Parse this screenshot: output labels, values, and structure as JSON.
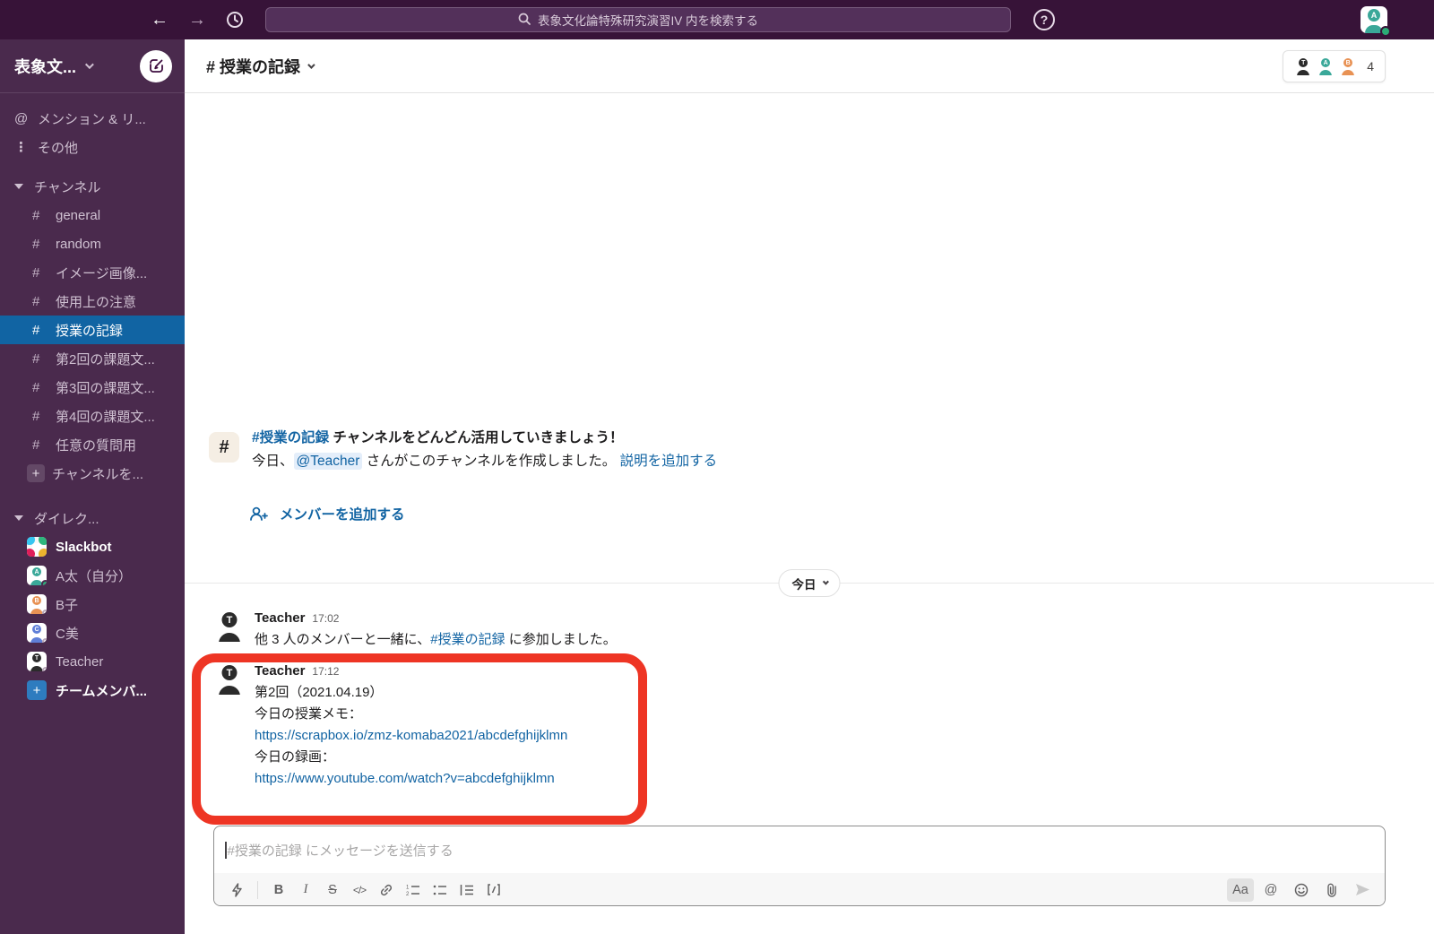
{
  "topbar": {
    "search_placeholder": "表象文化論特殊研究演習IV 内を検索する",
    "help_label": "?",
    "user_avatar_letter": "A"
  },
  "sidebar": {
    "workspace_name": "表象文...",
    "mentions_label": "メンション & リ...",
    "more_label": "その他",
    "channels_header": "チャンネル",
    "channels": [
      "general",
      "random",
      "イメージ画像...",
      "使用上の注意",
      "授業の記録",
      "第2回の課題文...",
      "第3回の課題文...",
      "第4回の課題文...",
      "任意の質問用"
    ],
    "add_channel_label": "チャンネルを...",
    "dm_header": "ダイレク...",
    "dms": [
      {
        "name": "Slackbot"
      },
      {
        "name": "A太（自分）",
        "letter": "A",
        "color": "#3aa899",
        "presence": "online"
      },
      {
        "name": "B子",
        "letter": "B",
        "color": "#e89254",
        "presence": "offline"
      },
      {
        "name": "C美",
        "letter": "C",
        "color": "#5f7fd8",
        "presence": "offline"
      },
      {
        "name": "Teacher",
        "letter": "T",
        "color": "#2b2b2b",
        "presence": "offline"
      }
    ],
    "invite_label": "チームメンバ..."
  },
  "channel_header": {
    "title": "# 授業の記録",
    "member_letters": [
      "T",
      "A",
      "B"
    ],
    "member_count": "4"
  },
  "intro": {
    "channel_link": "#授業の記録",
    "title_rest": " チャンネルをどんどん活用していきましょう！",
    "created_prefix": "今日、",
    "mention": "@Teacher",
    "created_suffix": " さんがこのチャンネルを作成しました。",
    "add_description_link": "説明を追加する",
    "add_members_label": "メンバーを追加する"
  },
  "divider_label": "今日",
  "messages": [
    {
      "author": "Teacher",
      "time": "17:02",
      "avatar_letter": "T",
      "body_prefix": "他 3 人のメンバーと一緒に、",
      "body_link": "#授業の記録",
      "body_suffix": " に参加しました。"
    },
    {
      "author": "Teacher",
      "time": "17:12",
      "avatar_letter": "T",
      "line1": "第2回（2021.04.19）",
      "line2": "今日の授業メモ：",
      "link1": "https://scrapbox.io/zmz-komaba2021/abcdefghijklmn",
      "line3": "今日の録画：",
      "link2": "https://www.youtube.com/watch?v=abcdefghijklmn"
    }
  ],
  "composer": {
    "placeholder": "#授業の記録 にメッセージを送信する",
    "format_button_label": "Aa"
  },
  "colors": {
    "topbar_bg": "#371338",
    "sidebar_bg": "#4a2a4d",
    "selected_channel_bg": "#1164a3",
    "link_blue": "#1264a3",
    "annotation_red": "#ee3524",
    "presence_online": "#2bac76",
    "avatar_teal": "#3aa899",
    "avatar_orange": "#e89254",
    "avatar_blue": "#5f7fd8",
    "avatar_black": "#2b2b2b"
  }
}
